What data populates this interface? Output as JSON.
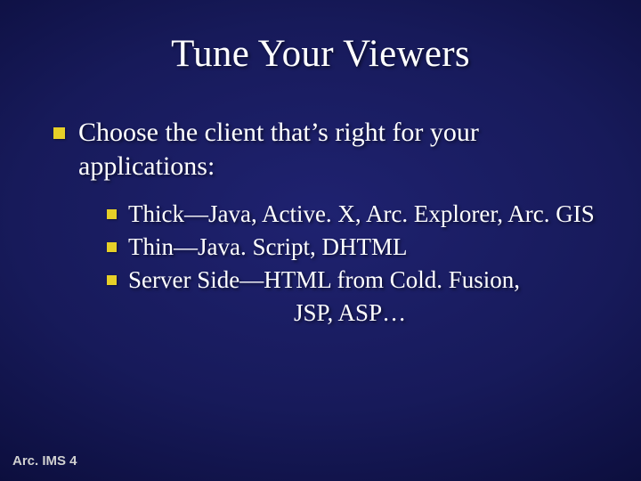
{
  "title": "Tune Your Viewers",
  "main": {
    "line1": "Choose the client that’s right for your",
    "line2": "applications:"
  },
  "sub": [
    "Thick—Java, Active. X, Arc. Explorer, Arc. GIS",
    "Thin—Java. Script, DHTML",
    "Server Side—HTML from Cold. Fusion,"
  ],
  "sub_cont": "JSP, ASP…",
  "footer": "Arc. IMS 4"
}
